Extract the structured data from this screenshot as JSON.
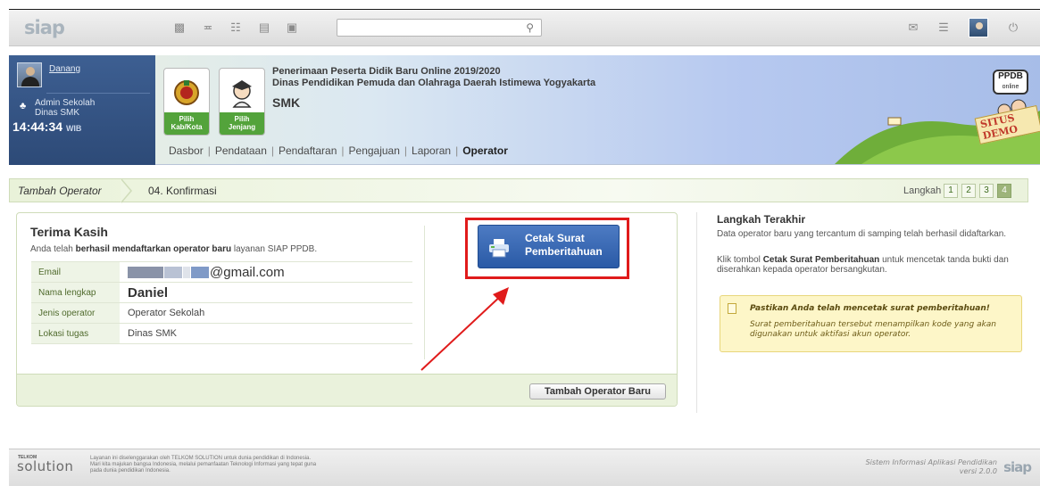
{
  "topbar": {
    "logo": "siap",
    "icons": [
      "cube-icon",
      "rss-icon",
      "sitemap-icon",
      "document-icon",
      "contact-card-icon"
    ],
    "search": {
      "value": "",
      "placeholder": ""
    },
    "right_icons": [
      "mail-icon",
      "list-icon",
      "avatar",
      "power-icon"
    ]
  },
  "user": {
    "name": "Danang",
    "role_line1": "Admin Sekolah",
    "role_line2": "Dinas SMK",
    "time": "14:44:34",
    "tz": "WIB"
  },
  "badges": [
    {
      "line1": "Pilih",
      "line2": "Kab/Kota"
    },
    {
      "line1": "Pilih",
      "line2": "Jenjang"
    }
  ],
  "header": {
    "title1": "Penerimaan Peserta Didik Baru Online 2019/2020",
    "title2": "Dinas Pendidikan Pemuda dan Olahraga Daerah Istimewa Yogyakarta",
    "sub": "SMK",
    "ppdb_logo": "PPDB",
    "ppdb_logo_sub": "online",
    "demo": "SITUS DEMO"
  },
  "nav": {
    "items": [
      "Dasbor",
      "Pendataan",
      "Pendaftaran",
      "Pengajuan",
      "Laporan",
      "Operator"
    ],
    "active": "Operator"
  },
  "steps": {
    "crumb1": "Tambah Operator",
    "crumb2": "04. Konfirmasi",
    "label": "Langkah",
    "numbers": [
      "1",
      "2",
      "3",
      "4"
    ],
    "current": "4"
  },
  "confirm": {
    "title": "Terima Kasih",
    "sub_pre": "Anda telah ",
    "sub_bold": "berhasil mendaftarkan operator baru",
    "sub_post": " layanan SIAP PPDB.",
    "rows": [
      {
        "label": "Email",
        "value": "@gmail.com"
      },
      {
        "label": "Nama lengkap",
        "value": "Daniel"
      },
      {
        "label": "Jenis operator",
        "value": "Operator Sekolah"
      },
      {
        "label": "Lokasi tugas",
        "value": "Dinas SMK"
      }
    ],
    "print_button_line1": "Cetak Surat",
    "print_button_line2": "Pemberitahuan",
    "add_button": "Tambah Operator Baru"
  },
  "info": {
    "title": "Langkah Terakhir",
    "p1": "Data operator baru yang tercantum di samping telah berhasil didaftarkan.",
    "p2_pre": "Klik tombol ",
    "p2_bold": "Cetak Surat Pemberitahuan",
    "p2_post": " untuk mencetak tanda bukti dan diserahkan kepada operator bersangkutan.",
    "note_title": "Pastikan Anda telah mencetak surat pemberitahuan!",
    "note_text": "Surat pemberitahuan tersebut menampilkan kode yang akan digunakan untuk aktifasi akun operator."
  },
  "footer": {
    "telkom": "TELKOM",
    "brand": "solution",
    "text1": "Layanan ini diselenggarakan oleh TELKOM SOLUTION untuk dunia pendidikan di Indonesia.",
    "text2": "Mari kita majukan bangsa Indonesia, melalui pemanfaatan Teknologi Informasi yang tepat guna",
    "text3": "pada dunia pendidikan Indonesia.",
    "right1": "Sistem Informasi Aplikasi Pendidikan",
    "right2": "versi 2.0.0",
    "logo": "siap"
  },
  "colors": {
    "highlight": "#e01b1b",
    "print_button": "#2a5aa6",
    "user_panel": "#2d4a77",
    "step_current": "#9db47a"
  }
}
